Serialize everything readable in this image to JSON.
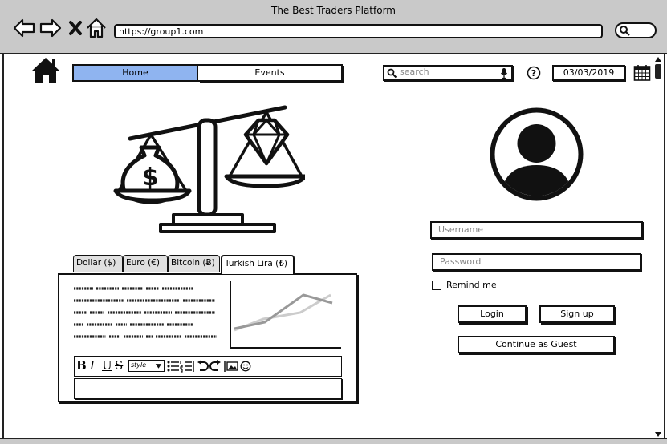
{
  "window": {
    "title": "The Best Traders Platform",
    "url": "https://group1.com"
  },
  "nav": {
    "home_label": "Home",
    "events_label": "Events"
  },
  "search": {
    "placeholder": "search"
  },
  "date": {
    "value": "03/03/2019"
  },
  "currency_tabs": {
    "dollar": "Dollar ($)",
    "euro": "Euro (€)",
    "bitcoin": "Bitcoin (Ƀ)",
    "lira": "Turkish Lira (₺)"
  },
  "editor": {
    "style_label": "style"
  },
  "login": {
    "username_placeholder": "Username",
    "password_placeholder": "Password",
    "remind_label": "Remind me",
    "login_label": "Login",
    "signup_label": "Sign up",
    "guest_label": "Continue as Guest"
  },
  "colors": {
    "chrome": "#c9c9c9",
    "nav_active": "#8fb4f0"
  },
  "icons": [
    "back-icon",
    "forward-icon",
    "close-icon",
    "home-icon",
    "browser-search-icon",
    "search-icon",
    "mic-icon",
    "help-icon",
    "calendar-icon",
    "scale-icon",
    "avatar-icon",
    "line-chart-icon",
    "bold-icon",
    "italic-icon",
    "underline-icon",
    "strikethrough-icon",
    "bullet-list-icon",
    "numbered-list-icon",
    "undo-icon",
    "redo-icon",
    "image-icon",
    "emoji-icon"
  ]
}
